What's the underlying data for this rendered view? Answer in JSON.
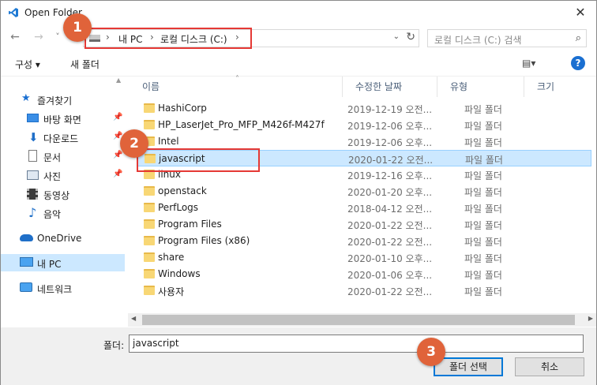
{
  "window": {
    "title": "Open Folder",
    "close_glyph": "✕"
  },
  "nav": {
    "back_glyph": "←",
    "forward_glyph": "→",
    "recent_glyph": "˅",
    "breadcrumb": [
      "내 PC",
      "로컬 디스크 (C:)"
    ],
    "crumb_separator": "›",
    "address_dropdown_glyph": "⌄",
    "refresh_glyph": "↻",
    "search_placeholder": "로컬 디스크 (C:) 검색",
    "search_glyph": "⌕"
  },
  "toolbar": {
    "organize_label": "구성 ▾",
    "new_folder_label": "새 폴더",
    "view_label": "▤▾",
    "help_label": "?"
  },
  "sidebar": {
    "items": [
      {
        "label": "즐겨찾기",
        "icon": "star-icon",
        "pinned": false
      },
      {
        "label": "바탕 화면",
        "icon": "desktop-icon",
        "pinned": true
      },
      {
        "label": "다운로드",
        "icon": "download-icon",
        "pinned": true
      },
      {
        "label": "문서",
        "icon": "document-icon",
        "pinned": true
      },
      {
        "label": "사진",
        "icon": "pictures-icon",
        "pinned": true
      },
      {
        "label": "동영상",
        "icon": "video-icon",
        "pinned": false
      },
      {
        "label": "음악",
        "icon": "music-icon",
        "pinned": false
      },
      {
        "label": "OneDrive",
        "icon": "cloud-icon",
        "pinned": false
      },
      {
        "label": "내 PC",
        "icon": "computer-icon",
        "pinned": false,
        "selected": true
      },
      {
        "label": "네트워크",
        "icon": "network-icon",
        "pinned": false
      }
    ]
  },
  "filelist": {
    "columns": [
      "이름",
      "수정한 날짜",
      "유형",
      "크기"
    ],
    "rows": [
      {
        "name": "HashiCorp",
        "date": "2019-12-19 오전...",
        "type": "파일 폴더"
      },
      {
        "name": "HP_LaserJet_Pro_MFP_M426f-M427f",
        "date": "2019-12-06 오후...",
        "type": "파일 폴더"
      },
      {
        "name": "Intel",
        "date": "2019-12-06 오후...",
        "type": "파일 폴더"
      },
      {
        "name": "javascript",
        "date": "2020-01-22 오전...",
        "type": "파일 폴더",
        "selected": true
      },
      {
        "name": "linux",
        "date": "2019-12-16 오후...",
        "type": "파일 폴더"
      },
      {
        "name": "openstack",
        "date": "2020-01-20 오후...",
        "type": "파일 폴더"
      },
      {
        "name": "PerfLogs",
        "date": "2018-04-12 오전...",
        "type": "파일 폴더"
      },
      {
        "name": "Program Files",
        "date": "2020-01-22 오전...",
        "type": "파일 폴더"
      },
      {
        "name": "Program Files (x86)",
        "date": "2020-01-22 오전...",
        "type": "파일 폴더"
      },
      {
        "name": "share",
        "date": "2020-01-10 오후...",
        "type": "파일 폴더"
      },
      {
        "name": "Windows",
        "date": "2020-01-06 오후...",
        "type": "파일 폴더"
      },
      {
        "name": "사용자",
        "date": "2020-01-22 오전...",
        "type": "파일 폴더"
      }
    ]
  },
  "bottom": {
    "folder_label": "폴더:",
    "folder_value": "javascript",
    "select_button": "폴더 선택",
    "cancel_button": "취소"
  },
  "annotations": [
    "1",
    "2",
    "3"
  ],
  "colors": {
    "accent": "#0078d7",
    "selection": "#cce8ff",
    "badge": "#e0633a",
    "highlight_box": "#e53935"
  }
}
